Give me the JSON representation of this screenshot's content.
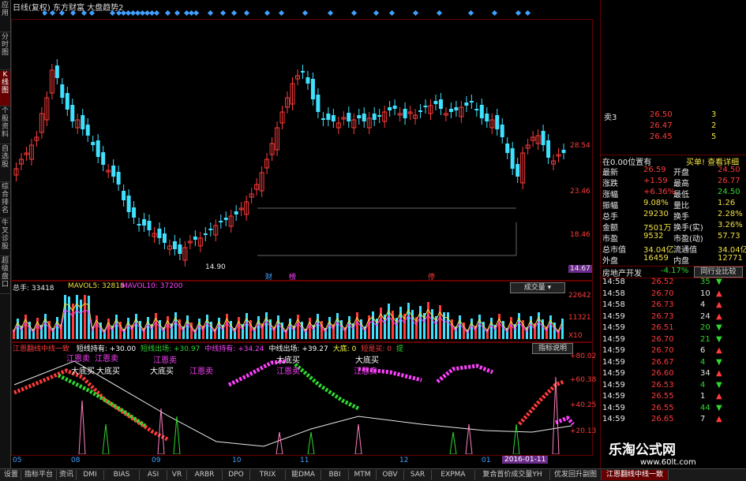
{
  "left_tabs": [
    "应用",
    "分时图",
    "K线图",
    "个股资料",
    "自选股",
    "综合排名",
    "牛叉诊股",
    "超级盘口"
  ],
  "header": {
    "main": "日线(复权) 东方财富 大盘趋势2"
  },
  "price_axis": [
    "28.54",
    "23.46",
    "18.46",
    "14.67"
  ],
  "low_label": "14.90",
  "event_marks": [
    "财",
    "榜",
    "停"
  ],
  "volume": {
    "title": "总手: 33418",
    "ma5": "MAVOL5: 32818",
    "ma10": "MAVOL10: 37200",
    "select_label": "成交量",
    "axis": [
      "22642",
      "11321",
      "X10"
    ]
  },
  "indicator": {
    "title": "江恩翻线中线一致",
    "items": [
      {
        "text": "短线持有: +30.00",
        "color": "#ffffff"
      },
      {
        "text": "短线出场: +30.97",
        "color": "#2fd82f"
      },
      {
        "text": "中线持有: +34.24",
        "color": "#ff40ff"
      },
      {
        "text": "中线出场: +39.27",
        "color": "#ffffff"
      },
      {
        "text": "大底: 0",
        "color": "#ffff40"
      },
      {
        "text": "短是买: 0",
        "color": "#ff3b3b"
      },
      {
        "text": "提",
        "color": "#2fd82f"
      }
    ],
    "explain_button": "指标说明",
    "axis": [
      "+80.02",
      "+60.38",
      "+40.25",
      "+20.13"
    ],
    "annotations": [
      "江恩卖",
      "江恩卖",
      "大底买",
      "大底买",
      "江恩卖",
      "大底买",
      "江恩卖",
      "大底买",
      "江恩卖",
      "大底买",
      "江恩卖"
    ]
  },
  "date_axis": [
    "05",
    "08",
    "09",
    "10",
    "11",
    "12",
    "01"
  ],
  "date_selected": "2016-01-11",
  "right_panel": {
    "order_book": [
      {
        "label": "卖3",
        "price": "26.50",
        "vol": "3"
      },
      {
        "label": "",
        "price": "26.47",
        "vol": "2"
      },
      {
        "label": "",
        "price": "26.45",
        "vol": "5"
      }
    ],
    "position_text": "在0.00位置有",
    "buy_detail": "买单! 查看详细",
    "stats": [
      {
        "l1": "最新",
        "v1": "26.59",
        "l2": "开盘",
        "v2": "24.50"
      },
      {
        "l1": "涨跌",
        "v1": "+1.59",
        "l2": "最高",
        "v2": "26.77"
      },
      {
        "l1": "涨幅",
        "v1": "+6.36%",
        "l2": "最低",
        "v2": "24.50"
      },
      {
        "l1": "振幅",
        "v1": "9.08%",
        "l2": "量比",
        "v2": "1.26"
      },
      {
        "l1": "总手",
        "v1": "29230",
        "l2": "换手",
        "v2": "2.28%"
      },
      {
        "l1": "金额",
        "v1": "7501万",
        "l2": "换手(实)",
        "v2": "3.26%"
      },
      {
        "l1": "市盈",
        "v1": "9532",
        "l2": "市盈(动)",
        "v2": "57.73"
      },
      {
        "l1": "总市值",
        "v1": "34.04亿",
        "l2": "流通值",
        "v2": "34.04亿"
      },
      {
        "l1": "外盘",
        "v1": "16459",
        "l2": "内盘",
        "v2": "12771"
      }
    ],
    "industry": {
      "name": "房地产开发",
      "change": "-4.17%",
      "button": "同行业比较"
    },
    "ticks": [
      {
        "t": "14:58",
        "p": "26.52",
        "v": "35",
        "d": "down"
      },
      {
        "t": "14:58",
        "p": "26.70",
        "v": "10",
        "d": "up"
      },
      {
        "t": "14:58",
        "p": "26.73",
        "v": "4",
        "d": "up"
      },
      {
        "t": "14:59",
        "p": "26.73",
        "v": "24",
        "d": "up"
      },
      {
        "t": "14:59",
        "p": "26.51",
        "v": "20",
        "d": "down"
      },
      {
        "t": "14:59",
        "p": "26.70",
        "v": "21",
        "d": "down"
      },
      {
        "t": "14:59",
        "p": "26.70",
        "v": "6",
        "d": "up"
      },
      {
        "t": "14:59",
        "p": "26.67",
        "v": "4",
        "d": "down"
      },
      {
        "t": "14:59",
        "p": "26.60",
        "v": "34",
        "d": "up"
      },
      {
        "t": "14:59",
        "p": "26.53",
        "v": "4",
        "d": "down"
      },
      {
        "t": "14:59",
        "p": "26.55",
        "v": "1",
        "d": "up"
      },
      {
        "t": "14:59",
        "p": "26.55",
        "v": "44",
        "d": "down"
      },
      {
        "t": "14:59",
        "p": "26.65",
        "v": "7",
        "d": "up"
      }
    ]
  },
  "bottom_tabs": [
    "设置",
    "指标平台",
    "资讯",
    "DMI",
    "BIAS",
    "ASI",
    "VR",
    "ARBR",
    "DPO",
    "TRIX",
    "能DMA",
    "BBI",
    "MTM",
    "OBV",
    "SAR",
    "EXPMA",
    "复合首价成交量YH",
    "优发回升副图",
    "江恩翻线中线一致"
  ],
  "watermark": {
    "title": "乐淘公式网",
    "url": "www.60lt.com"
  },
  "colors": {
    "up": "#ff3b3b",
    "down": "#40e0ff",
    "ma": "#ffffff",
    "frame": "#660000",
    "accent": "#ff40ff",
    "green": "#2fd82f"
  }
}
